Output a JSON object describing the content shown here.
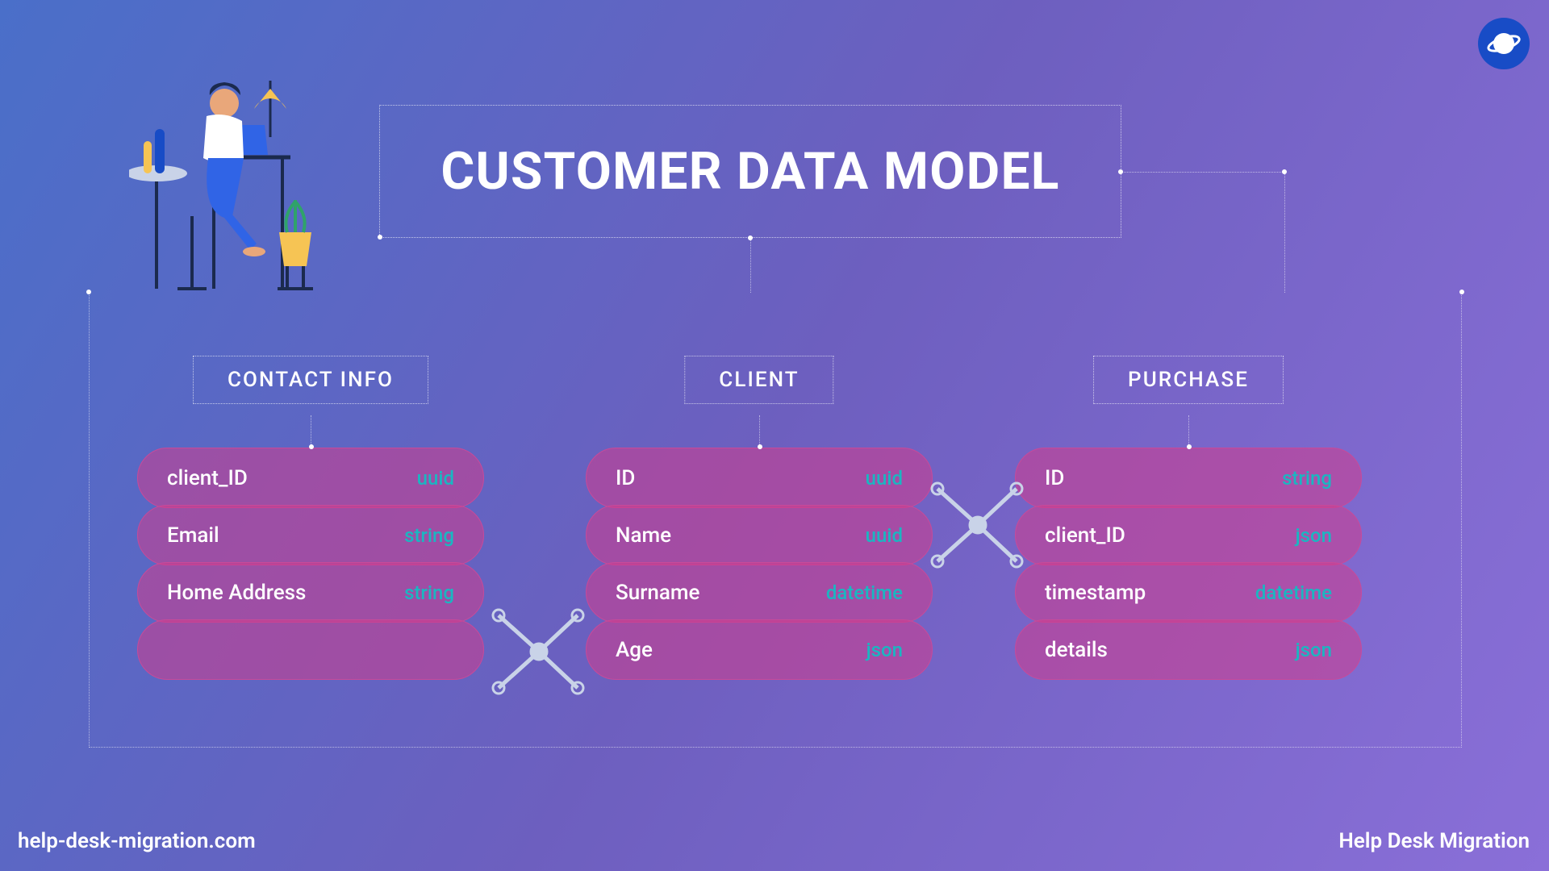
{
  "title": "CUSTOMER DATA MODEL",
  "logo_name": "planet-icon",
  "entities": {
    "contact": {
      "label": "CONTACT INFO",
      "fields": [
        {
          "name": "client_ID",
          "type": "uuid"
        },
        {
          "name": "Email",
          "type": "string"
        },
        {
          "name": "Home Address",
          "type": "string"
        },
        {
          "name": "",
          "type": ""
        }
      ]
    },
    "client": {
      "label": "CLIENT",
      "fields": [
        {
          "name": "ID",
          "type": "uuid"
        },
        {
          "name": "Name",
          "type": "uuid"
        },
        {
          "name": "Surname",
          "type": "datetime"
        },
        {
          "name": "Age",
          "type": "json"
        }
      ]
    },
    "purchase": {
      "label": "PURCHASE",
      "fields": [
        {
          "name": "ID",
          "type": "string"
        },
        {
          "name": "client_ID",
          "type": "json"
        },
        {
          "name": "timestamp",
          "type": "datetime"
        },
        {
          "name": "details",
          "type": "json"
        }
      ]
    }
  },
  "footer": {
    "left": "help-desk-migration.com",
    "right": "Help Desk Migration"
  },
  "colors": {
    "pill_bg": "#c84a99",
    "type_text": "#1bb6c1",
    "bg_from": "#4a6fc9",
    "bg_to": "#8a6fd8"
  }
}
